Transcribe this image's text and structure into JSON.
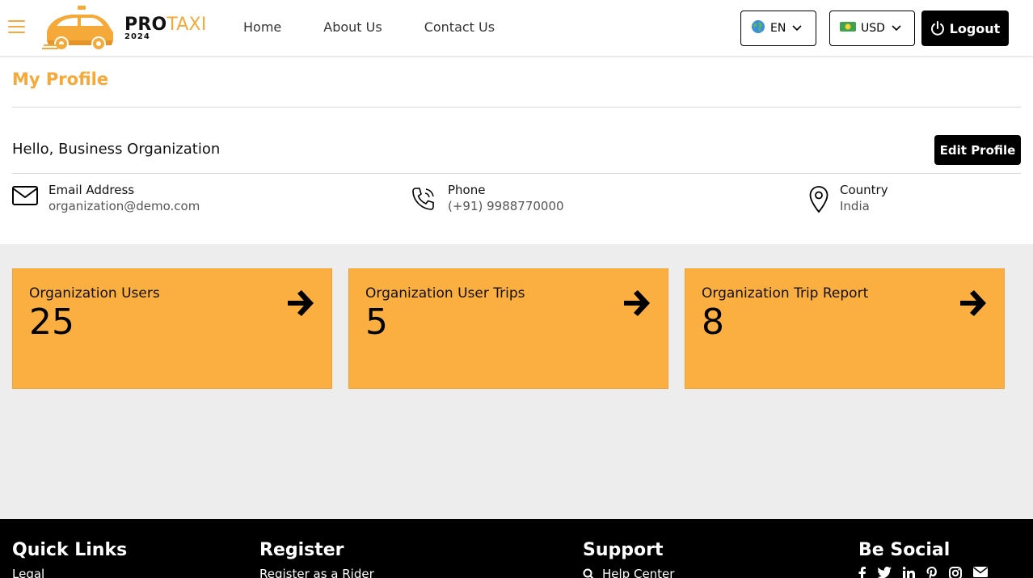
{
  "header": {
    "brand_pro": "PRO",
    "brand_taxi": "TAXI",
    "brand_year": "2024",
    "nav": [
      "Home",
      "About Us",
      "Contact Us"
    ],
    "language": "EN",
    "currency": "USD",
    "logout_label": "Logout"
  },
  "profile": {
    "title": "My Profile",
    "greeting": "Hello, Business Organization",
    "edit_label": "Edit Profile",
    "email_label": "Email Address",
    "email_value": "organization@demo.com",
    "phone_label": "Phone",
    "phone_value": "(+91) 9988770000",
    "country_label": "Country",
    "country_value": "India"
  },
  "cards": [
    {
      "title": "Organization Users",
      "value": "25"
    },
    {
      "title": "Organization User Trips",
      "value": "5"
    },
    {
      "title": "Organization Trip Report",
      "value": "8"
    }
  ],
  "footer": {
    "quick_links_title": "Quick Links",
    "quick_links_first": "Legal",
    "register_title": "Register",
    "register_first": "Register as a Rider",
    "support_title": "Support",
    "support_first": "Help Center",
    "social_title": "Be Social",
    "social_icons": [
      "facebook-icon",
      "twitter-icon",
      "linkedin-icon",
      "pinterest-icon",
      "instagram-icon",
      "email-icon"
    ]
  },
  "colors": {
    "accent": "#f4a938",
    "card": "#fbaf40",
    "band": "#ededed",
    "footer": "#000000"
  }
}
